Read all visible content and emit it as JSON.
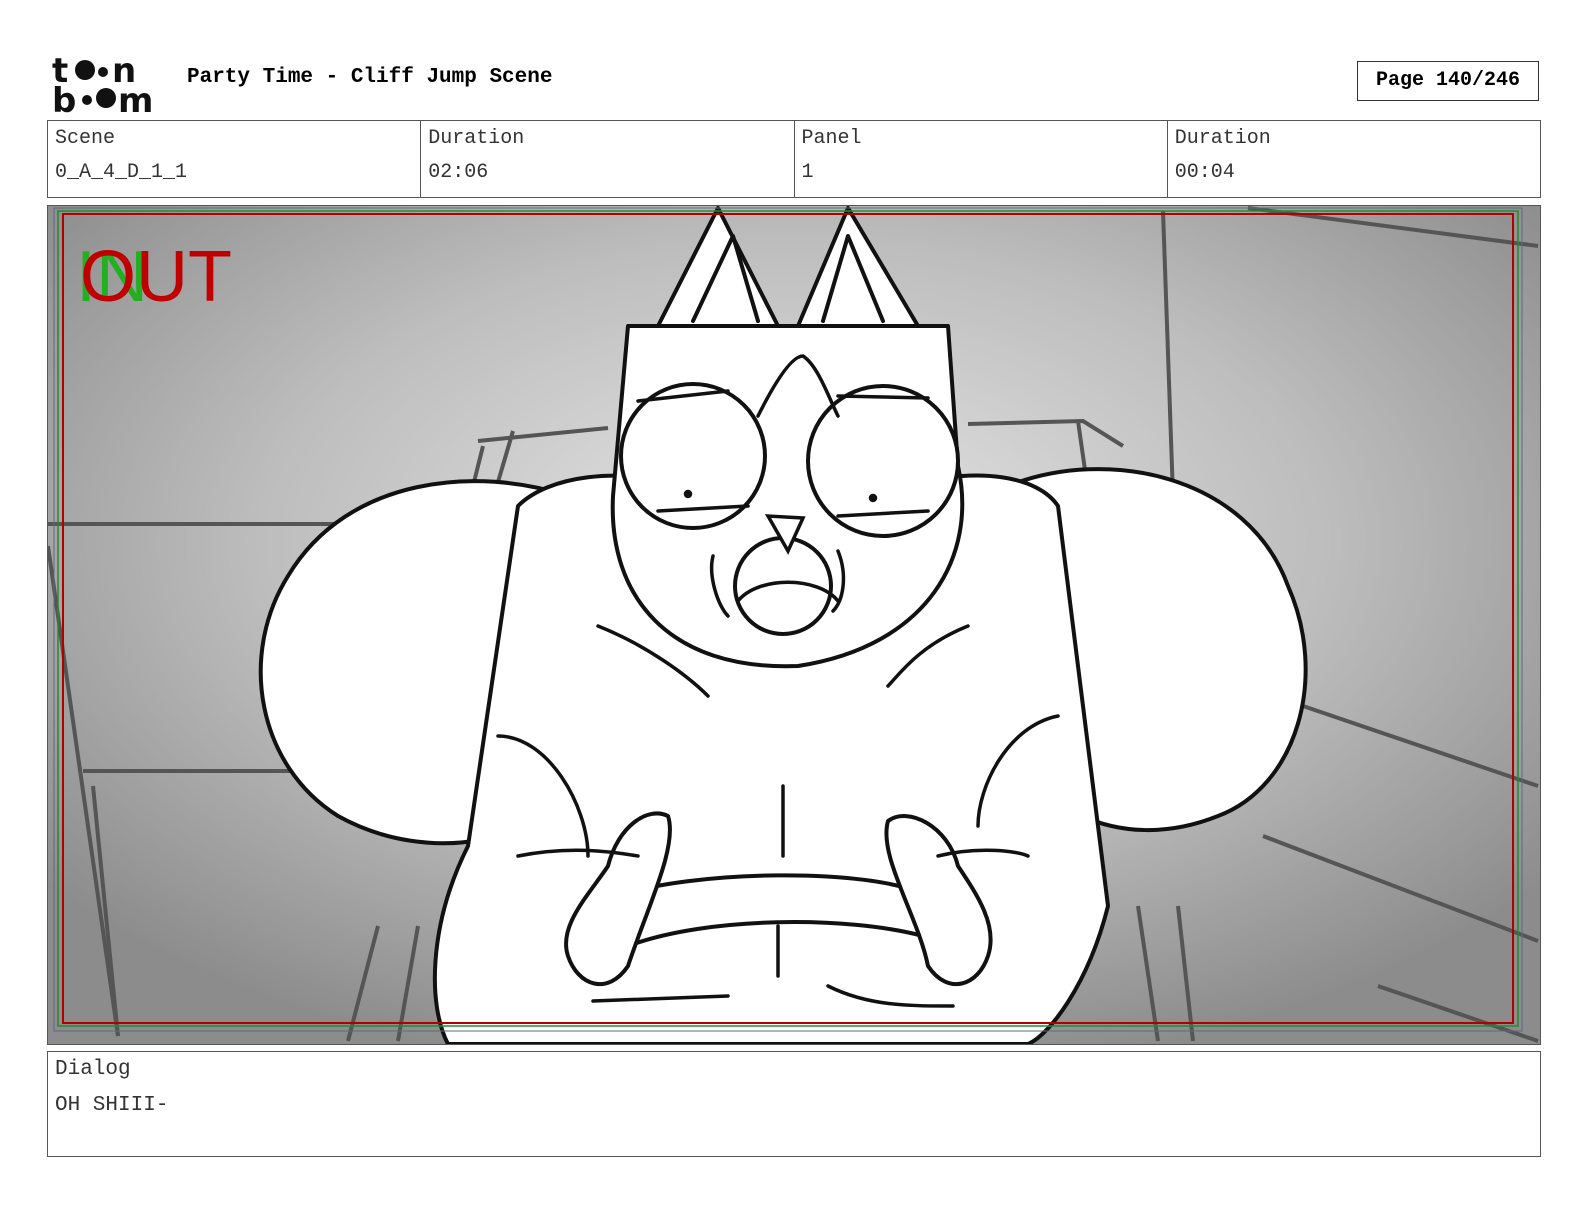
{
  "header": {
    "project_title": "Party Time - Cliff Jump Scene",
    "page_label": "Page 140/246"
  },
  "info": {
    "scene_label": "Scene",
    "scene_value": "0_A_4_D_1_1",
    "scene_duration_label": "Duration",
    "scene_duration_value": "02:06",
    "panel_label": "Panel",
    "panel_value": "1",
    "panel_duration_label": "Duration",
    "panel_duration_value": "00:04"
  },
  "panel": {
    "in_marker": "IN",
    "out_marker": "OUT",
    "in_color": "#22b022",
    "out_color": "#c00000"
  },
  "dialog": {
    "label": "Dialog",
    "text": "OH SHIII-"
  }
}
